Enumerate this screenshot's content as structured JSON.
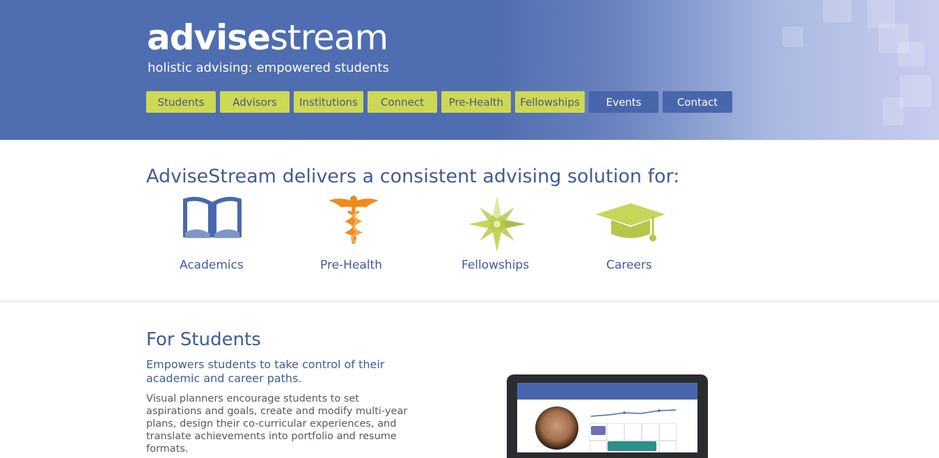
{
  "brand": {
    "logo_bold": "advise",
    "logo_light": "stream",
    "tagline": "holistic advising: empowered students"
  },
  "nav": {
    "items": [
      {
        "label": "Students",
        "style": "green"
      },
      {
        "label": "Advisors",
        "style": "green"
      },
      {
        "label": "Institutions",
        "style": "green"
      },
      {
        "label": "Connect",
        "style": "green"
      },
      {
        "label": "Pre-Health",
        "style": "green"
      },
      {
        "label": "Fellowships",
        "style": "green"
      },
      {
        "label": "Events",
        "style": "blue"
      },
      {
        "label": "Contact",
        "style": "blue"
      }
    ]
  },
  "solutions": {
    "title": "AdviseStream delivers a consistent advising solution for:",
    "items": [
      {
        "label": "Academics",
        "icon": "open-book-icon"
      },
      {
        "label": "Pre-Health",
        "icon": "caduceus-icon"
      },
      {
        "label": "Fellowships",
        "icon": "compass-star-icon"
      },
      {
        "label": "Careers",
        "icon": "graduation-cap-icon"
      }
    ]
  },
  "students": {
    "title": "For Students",
    "subtitle": "Empowers students to take control of their academic and career paths.",
    "body": "Visual planners encourage students to set aspirations and goals, create and modify multi-year plans, design their co-curricular experiences, and translate achievements into portfolio and resume formats."
  },
  "colors": {
    "brand_blue": "#4f6db1",
    "nav_green": "#cdd855",
    "nav_blue": "#4866ac",
    "heading_blue": "#3f5b99",
    "icon_orange": "#f08a1c",
    "icon_green": "#c6d65a"
  }
}
